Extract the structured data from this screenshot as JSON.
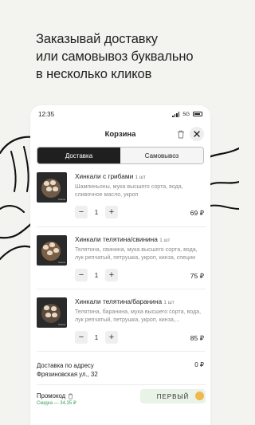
{
  "headline": {
    "line1": "Заказывай доставку",
    "line2": "или самовывоз буквально",
    "line3": "в несколько кликов"
  },
  "status_bar": {
    "time": "12:35",
    "network": "5G"
  },
  "cart": {
    "title": "Корзина",
    "tabs": [
      {
        "label": "Доставка",
        "active": true
      },
      {
        "label": "Самовывоз",
        "active": false
      }
    ],
    "items": [
      {
        "name": "Хинкали с грибами",
        "qty_note": "1 шт",
        "desc": "Шампиньоны, мука высшего сорта, вода, сливочное масло, укроп",
        "quantity": "1",
        "price": "69 ₽",
        "minus": "−",
        "plus": "+",
        "image_label": "Grains"
      },
      {
        "name": "Хинкали телятина/свинина",
        "qty_note": "1 шт",
        "desc": "Телятина, свинина, мука высшего сорта, вода, лук репчатый, петрушка, укроп, кинза, специи",
        "quantity": "1",
        "price": "75 ₽",
        "minus": "−",
        "plus": "+",
        "image_label": "Grains"
      },
      {
        "name": "Хинкали телятина/баранина",
        "qty_note": "1 шт",
        "desc": "Телятина, баранина, мука высшего сорта, вода, лук репчатый, петрушка, укроп, кинза,...",
        "quantity": "1",
        "price": "85 ₽",
        "minus": "−",
        "plus": "+",
        "image_label": "Grains"
      }
    ],
    "delivery": {
      "label_line1": "Доставка по адресу",
      "label_line2": "Фрязиновская ул., 32",
      "price": "0 ₽"
    },
    "promo": {
      "label": "Промокод",
      "discount": "Скидка — 34,35 ₽",
      "code": "ПЕРВЫЙ"
    }
  },
  "colors": {
    "background": "#f3f3ef",
    "active_tab": "#1f1f1f",
    "promo_green": "#3aa05a",
    "promo_field": "#e9f3e7"
  }
}
